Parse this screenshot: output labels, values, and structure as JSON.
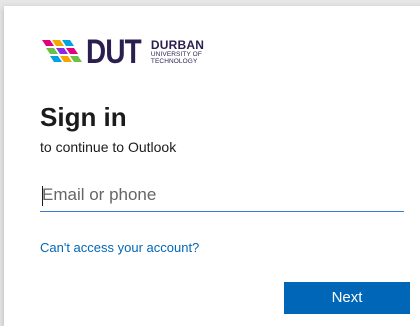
{
  "logo": {
    "acronym": "DUT",
    "line1": "DURBAN",
    "line2": "UNIVERSITY OF",
    "line3": "TECHNOLOGY",
    "brand_color": "#2a1f4e",
    "mark_colors": [
      "#e4007c",
      "#f7a600",
      "#00a3e0",
      "#6cc04a",
      "#8a2be2"
    ]
  },
  "signin": {
    "title": "Sign in",
    "subtitle": "to continue to Outlook"
  },
  "email": {
    "placeholder": "Email or phone",
    "value": ""
  },
  "links": {
    "cant_access": "Can't access your account?"
  },
  "actions": {
    "next_label": "Next"
  },
  "colors": {
    "accent": "#0067b8",
    "input_underline": "#3a7bd5",
    "background": "#e6e6e6",
    "card": "#ffffff"
  }
}
